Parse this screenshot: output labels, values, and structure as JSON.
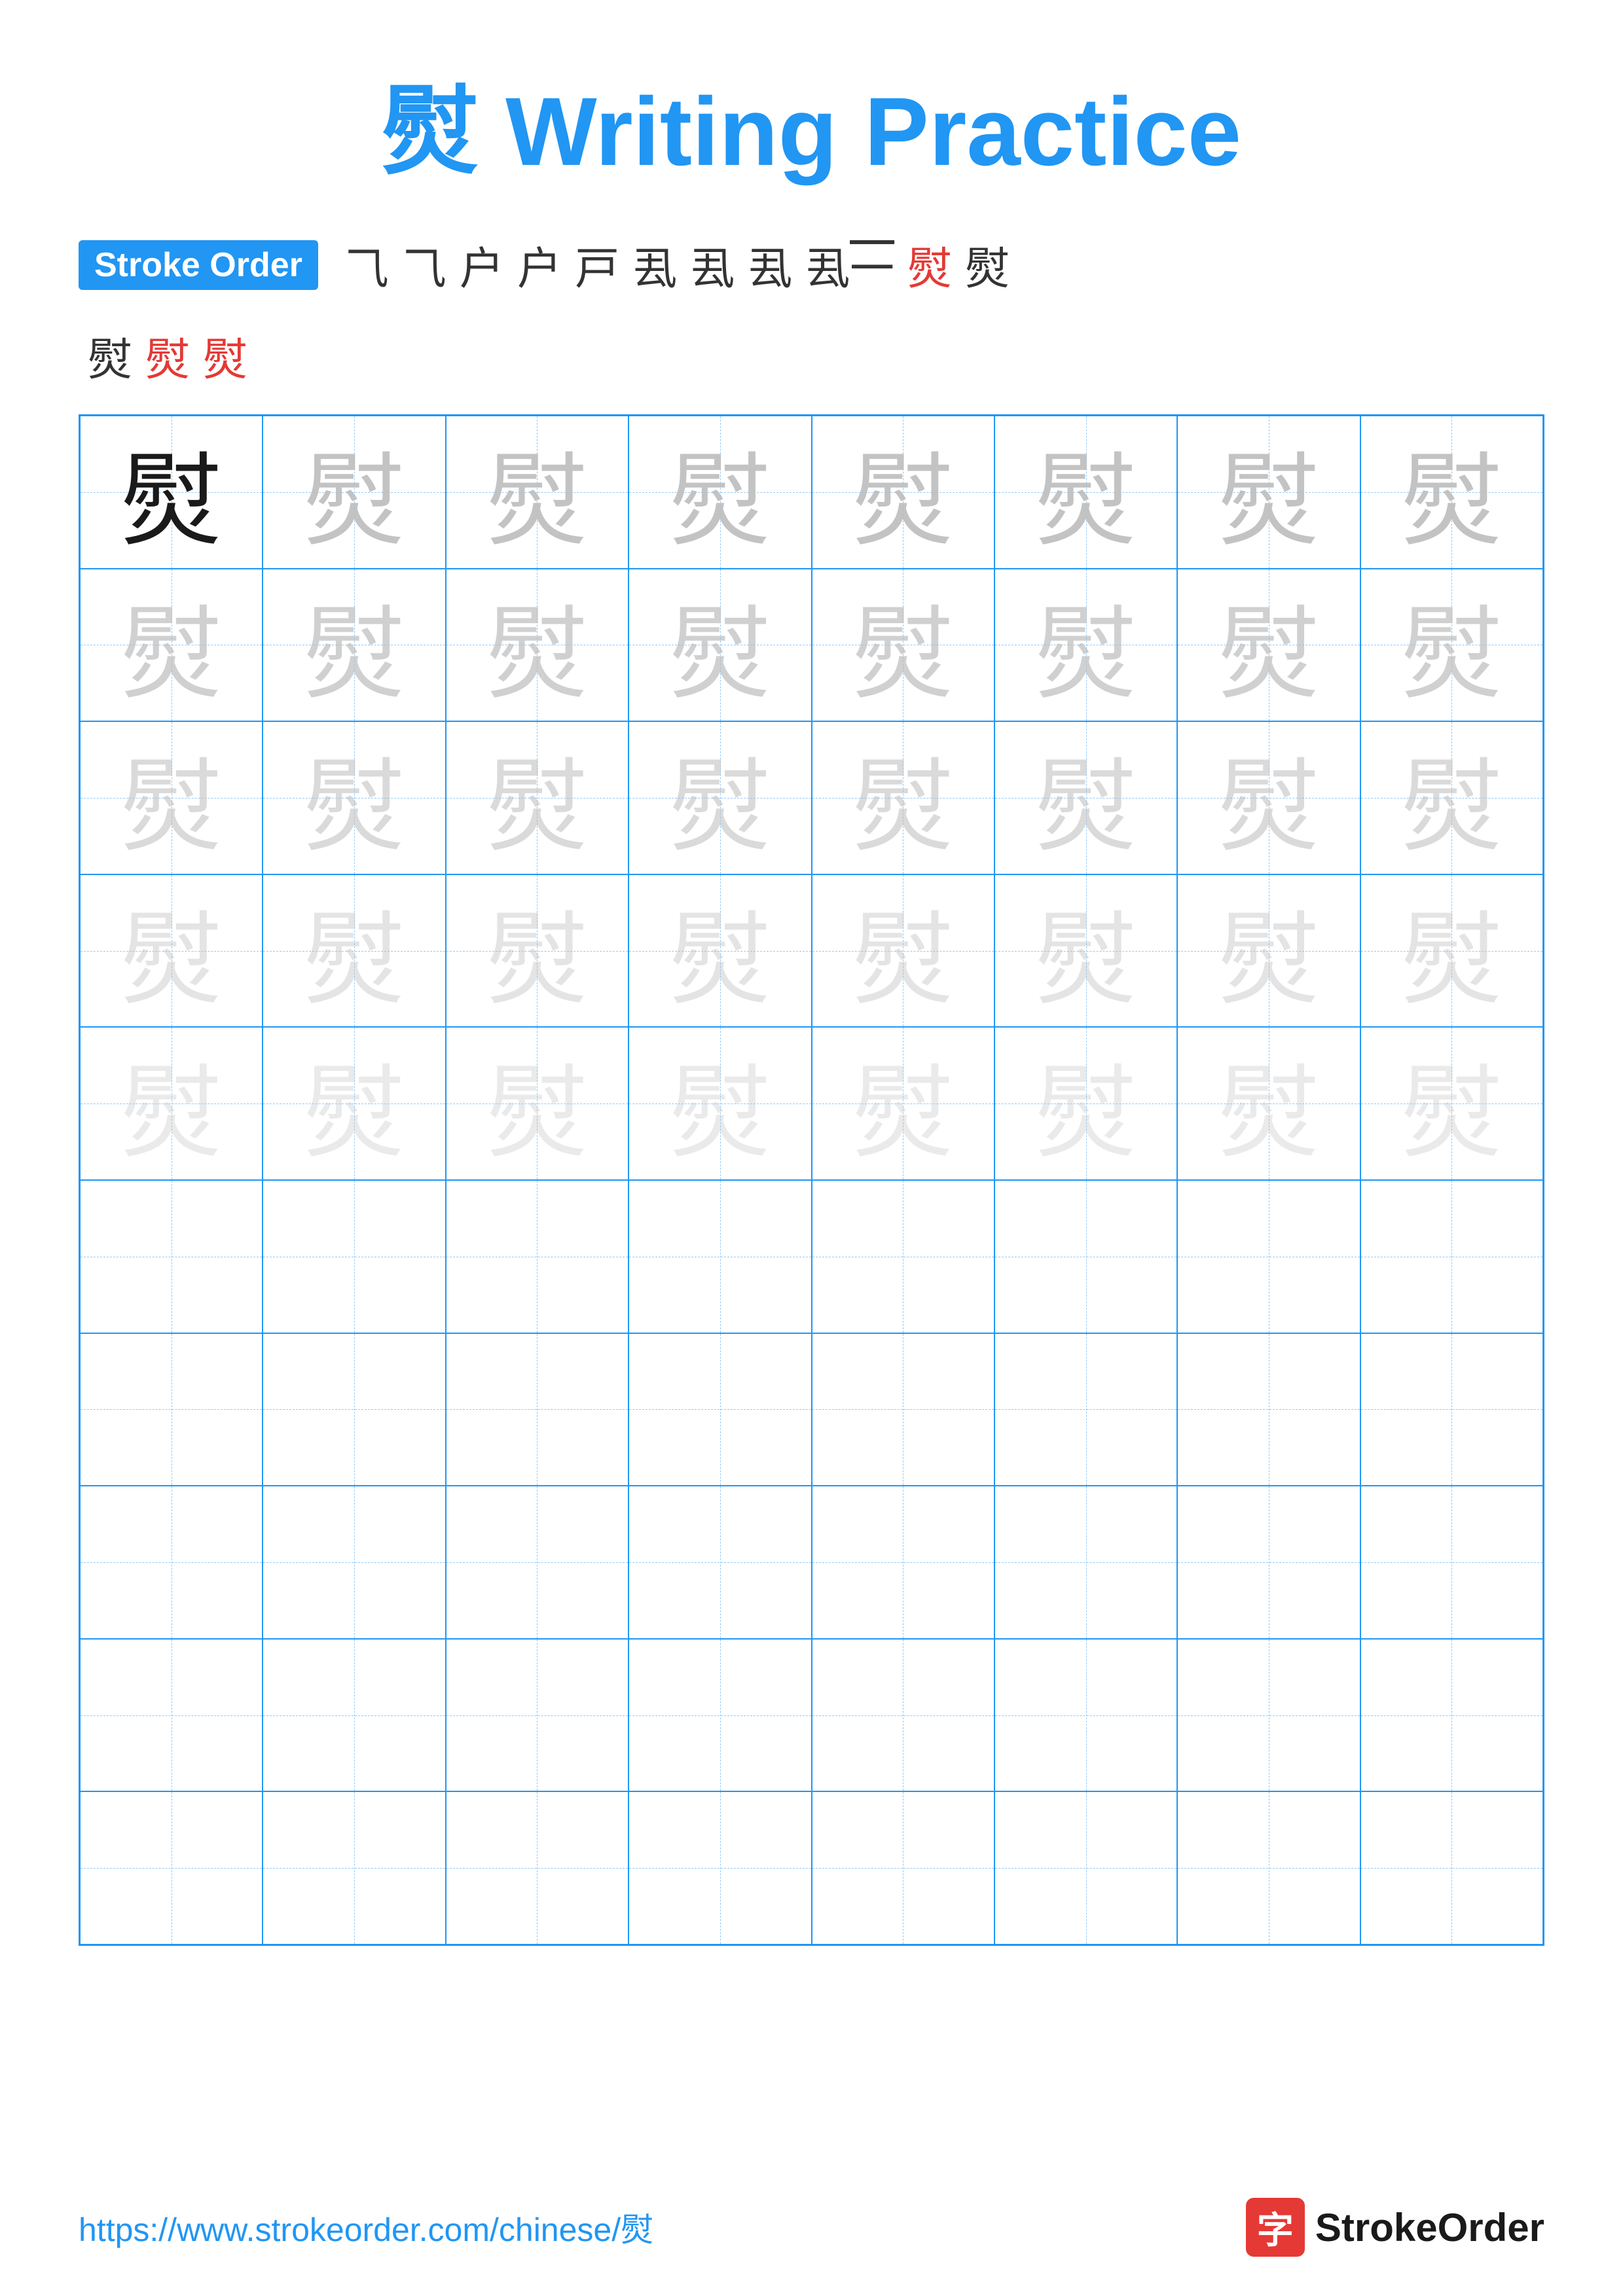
{
  "title": "熨 Writing Practice",
  "stroke_order": {
    "badge": "Stroke Order",
    "strokes_row1": [
      "⺄",
      "⺄",
      "户",
      "户",
      "戸",
      "厾",
      "厾",
      "厾",
      "厾⼀",
      "熨",
      "熨"
    ],
    "strokes_row2": [
      "熨",
      "熨",
      "熨"
    ]
  },
  "character": "熨",
  "grid": {
    "cols": 8,
    "rows": 10,
    "practice_rows": 5,
    "empty_rows": 5
  },
  "footer": {
    "url": "https://www.strokeorder.com/chinese/熨",
    "logo_char": "字",
    "logo_name": "StrokeOrder"
  }
}
